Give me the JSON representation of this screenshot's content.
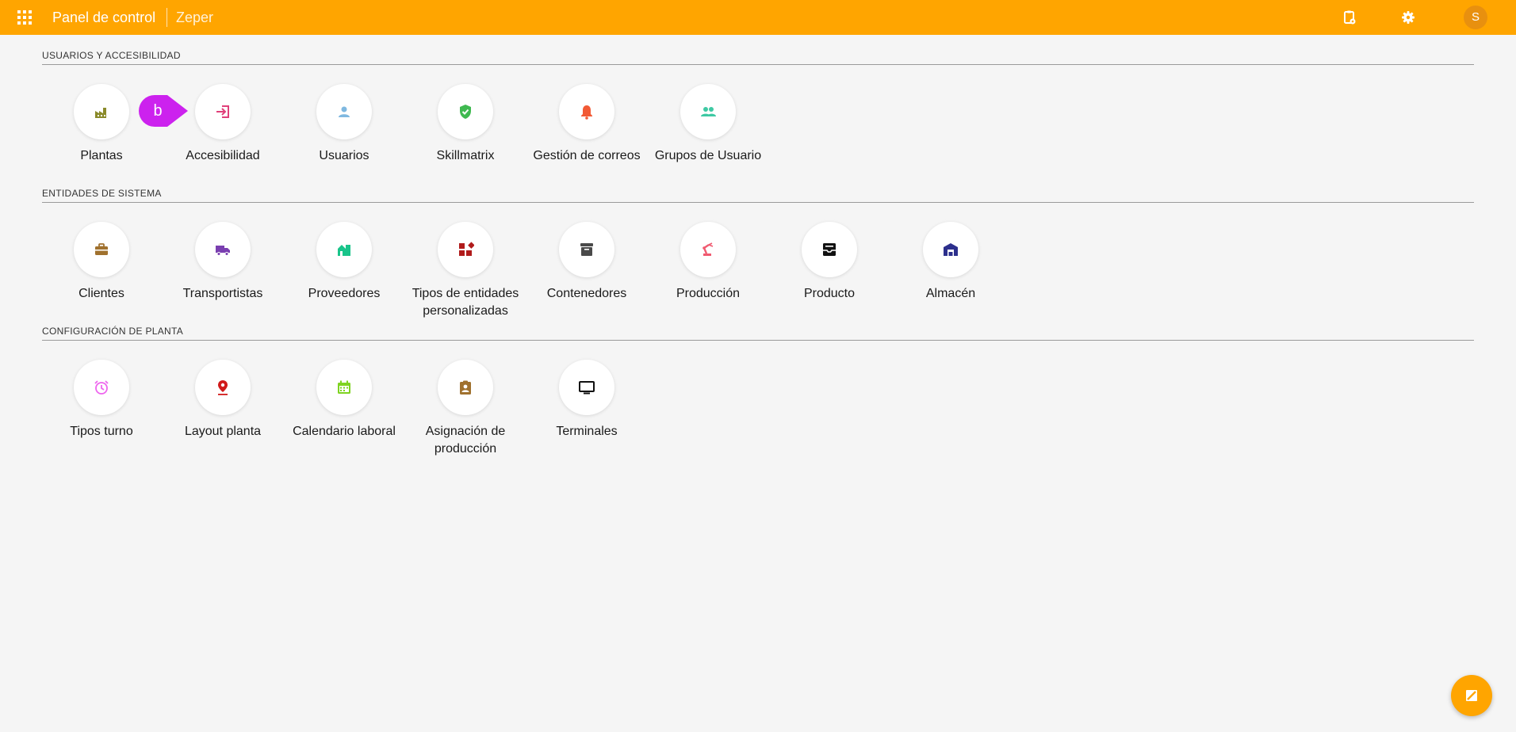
{
  "header": {
    "app_title": "Panel de control",
    "company": "Zeper",
    "avatar_initial": "S",
    "background_color": "#ffa500"
  },
  "marker": {
    "label": "b",
    "color": "#cc22ee"
  },
  "sections": [
    {
      "title": "USUARIOS Y ACCESIBILIDAD",
      "items": [
        {
          "label": "Plantas",
          "icon": "factory-icon",
          "color": "#8a8a2a"
        },
        {
          "label": "Accesibilidad",
          "icon": "login-icon",
          "color": "#e0407a"
        },
        {
          "label": "Usuarios",
          "icon": "person-icon",
          "color": "#7fb8e0"
        },
        {
          "label": "Skillmatrix",
          "icon": "shield-check-icon",
          "color": "#3fb950"
        },
        {
          "label": "Gestión de correos",
          "icon": "bell-icon",
          "color": "#f25a35"
        },
        {
          "label": "Grupos de Usuario",
          "icon": "group-icon",
          "color": "#3ec9a3"
        }
      ]
    },
    {
      "title": "ENTIDADES DE SISTEMA",
      "items": [
        {
          "label": "Clientes",
          "icon": "briefcase-icon",
          "color": "#a0712e"
        },
        {
          "label": "Transportistas",
          "icon": "truck-icon",
          "color": "#7a3fb0"
        },
        {
          "label": "Proveedores",
          "icon": "store-icon",
          "color": "#19c48a"
        },
        {
          "label": "Tipos de entidades personalizadas",
          "icon": "widgets-icon",
          "color": "#b01b1b"
        },
        {
          "label": "Contenedores",
          "icon": "archive-icon",
          "color": "#4a4a4a"
        },
        {
          "label": "Producción",
          "icon": "robot-arm-icon",
          "color": "#f05a70"
        },
        {
          "label": "Producto",
          "icon": "inbox-icon",
          "color": "#111111"
        },
        {
          "label": "Almacén",
          "icon": "warehouse-icon",
          "color": "#2c2f8c"
        }
      ]
    },
    {
      "title": "CONFIGURACIÓN DE PLANTA",
      "items": [
        {
          "label": "Tipos turno",
          "icon": "alarm-icon",
          "color": "#ee66ee"
        },
        {
          "label": "Layout planta",
          "icon": "map-pin-icon",
          "color": "#d11a1a"
        },
        {
          "label": "Calendario laboral",
          "icon": "calendar-icon",
          "color": "#7ed321"
        },
        {
          "label": "Asignación de producción",
          "icon": "assignment-ind-icon",
          "color": "#a0712e"
        },
        {
          "label": "Terminales",
          "icon": "monitor-icon",
          "color": "#111111"
        }
      ]
    }
  ]
}
